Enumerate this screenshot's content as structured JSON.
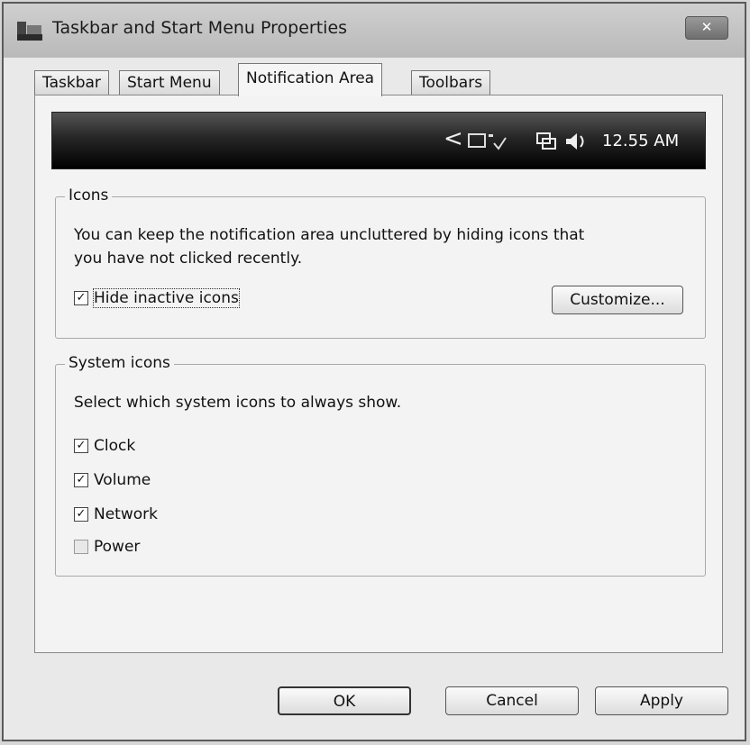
{
  "window": {
    "title": "Taskbar and Start Menu Properties",
    "close_label": "✕"
  },
  "tabs": [
    {
      "label": "Taskbar"
    },
    {
      "label": "Start Menu"
    },
    {
      "label": "Notification Area"
    },
    {
      "label": "Toolbars"
    }
  ],
  "active_tab": "Notification Area",
  "preview": {
    "chevron": "<",
    "time": "12.55 AM"
  },
  "icons_group": {
    "legend": "Icons",
    "description_line1": "You can keep the notification area uncluttered by hiding icons that",
    "description_line2": "you have not clicked recently.",
    "hide_inactive": {
      "label": "Hide inactive icons",
      "checked": true
    },
    "customize_label": "Customize..."
  },
  "system_group": {
    "legend": "System icons",
    "description": "Select which system icons to always show.",
    "items": [
      {
        "label": "Clock",
        "checked": true
      },
      {
        "label": "Volume",
        "checked": true
      },
      {
        "label": "Network",
        "checked": true
      },
      {
        "label": "Power",
        "checked": false
      }
    ]
  },
  "buttons": {
    "ok": "OK",
    "cancel": "Cancel",
    "apply": "Apply"
  },
  "colors": {
    "taskbar": "#262626",
    "dialog": "#f3f3f3"
  }
}
